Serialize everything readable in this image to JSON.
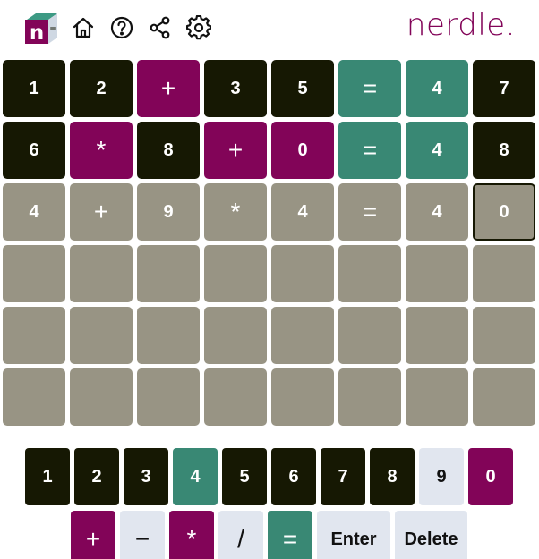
{
  "header": {
    "brand": "nerdle.",
    "logo_letter": "n",
    "icons": [
      "home-icon",
      "help-icon",
      "share-icon",
      "settings-icon"
    ]
  },
  "colors": {
    "correct": "#398874",
    "present": "#820458",
    "absent": "#161803",
    "empty": "#989484",
    "unused_key": "#e1e6ef",
    "brand": "#820458"
  },
  "board": {
    "rows": [
      [
        {
          "ch": "1",
          "state": "absent"
        },
        {
          "ch": "2",
          "state": "absent"
        },
        {
          "ch": "+",
          "state": "present"
        },
        {
          "ch": "3",
          "state": "absent"
        },
        {
          "ch": "5",
          "state": "absent"
        },
        {
          "ch": "=",
          "state": "correct"
        },
        {
          "ch": "4",
          "state": "correct"
        },
        {
          "ch": "7",
          "state": "absent"
        }
      ],
      [
        {
          "ch": "6",
          "state": "absent"
        },
        {
          "ch": "*",
          "state": "present"
        },
        {
          "ch": "8",
          "state": "absent"
        },
        {
          "ch": "+",
          "state": "present"
        },
        {
          "ch": "0",
          "state": "present"
        },
        {
          "ch": "=",
          "state": "correct"
        },
        {
          "ch": "4",
          "state": "correct"
        },
        {
          "ch": "8",
          "state": "absent"
        }
      ],
      [
        {
          "ch": "4",
          "state": "empty"
        },
        {
          "ch": "+",
          "state": "empty"
        },
        {
          "ch": "9",
          "state": "empty"
        },
        {
          "ch": "*",
          "state": "empty"
        },
        {
          "ch": "4",
          "state": "empty"
        },
        {
          "ch": "=",
          "state": "empty"
        },
        {
          "ch": "4",
          "state": "empty"
        },
        {
          "ch": "0",
          "state": "current"
        }
      ],
      [
        {
          "ch": "",
          "state": "empty"
        },
        {
          "ch": "",
          "state": "empty"
        },
        {
          "ch": "",
          "state": "empty"
        },
        {
          "ch": "",
          "state": "empty"
        },
        {
          "ch": "",
          "state": "empty"
        },
        {
          "ch": "",
          "state": "empty"
        },
        {
          "ch": "",
          "state": "empty"
        },
        {
          "ch": "",
          "state": "empty"
        }
      ],
      [
        {
          "ch": "",
          "state": "empty"
        },
        {
          "ch": "",
          "state": "empty"
        },
        {
          "ch": "",
          "state": "empty"
        },
        {
          "ch": "",
          "state": "empty"
        },
        {
          "ch": "",
          "state": "empty"
        },
        {
          "ch": "",
          "state": "empty"
        },
        {
          "ch": "",
          "state": "empty"
        },
        {
          "ch": "",
          "state": "empty"
        }
      ],
      [
        {
          "ch": "",
          "state": "empty"
        },
        {
          "ch": "",
          "state": "empty"
        },
        {
          "ch": "",
          "state": "empty"
        },
        {
          "ch": "",
          "state": "empty"
        },
        {
          "ch": "",
          "state": "empty"
        },
        {
          "ch": "",
          "state": "empty"
        },
        {
          "ch": "",
          "state": "empty"
        },
        {
          "ch": "",
          "state": "empty"
        }
      ]
    ]
  },
  "keyboard": {
    "digits": [
      {
        "label": "1",
        "state": "absent"
      },
      {
        "label": "2",
        "state": "absent"
      },
      {
        "label": "3",
        "state": "absent"
      },
      {
        "label": "4",
        "state": "correct"
      },
      {
        "label": "5",
        "state": "absent"
      },
      {
        "label": "6",
        "state": "absent"
      },
      {
        "label": "7",
        "state": "absent"
      },
      {
        "label": "8",
        "state": "absent"
      },
      {
        "label": "9",
        "state": "unused"
      },
      {
        "label": "0",
        "state": "present"
      }
    ],
    "operators": [
      {
        "label": "+",
        "state": "present",
        "name": "plus"
      },
      {
        "label": "−",
        "state": "unused",
        "name": "minus"
      },
      {
        "label": "*",
        "state": "present",
        "name": "multiply"
      },
      {
        "label": "/",
        "state": "unused",
        "name": "divide"
      },
      {
        "label": "=",
        "state": "correct",
        "name": "equals"
      }
    ],
    "enter_label": "Enter",
    "delete_label": "Delete"
  }
}
